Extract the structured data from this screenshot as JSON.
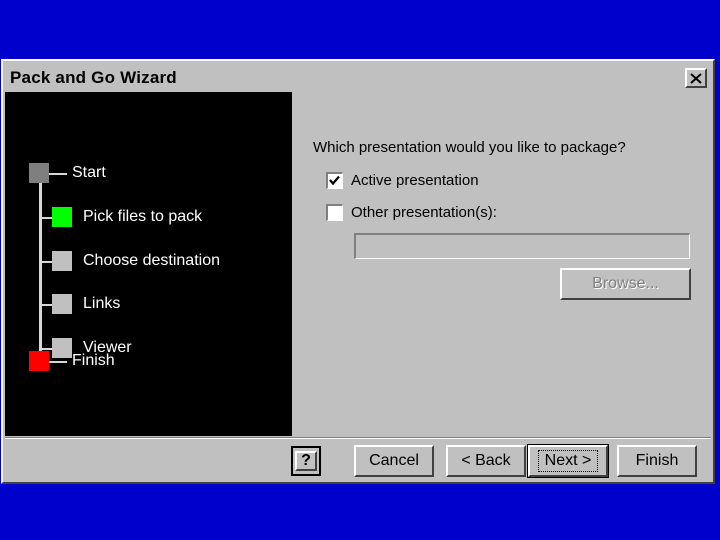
{
  "window": {
    "title": "Pack and Go Wizard",
    "close_icon": "close-icon"
  },
  "steps": [
    {
      "label": "Start",
      "color": "#7f7f7f"
    },
    {
      "label": "Pick files to pack",
      "color": "#00ff00"
    },
    {
      "label": "Choose destination",
      "color": "#c0c0c0"
    },
    {
      "label": "Links",
      "color": "#c0c0c0"
    },
    {
      "label": "Viewer",
      "color": "#c0c0c0"
    },
    {
      "label": "Finish",
      "color": "#ff0000"
    }
  ],
  "content": {
    "question": "Which presentation would you like to package?",
    "options": [
      {
        "label": "Active presentation",
        "checked": true
      },
      {
        "label": "Other presentation(s):",
        "checked": false
      }
    ],
    "path_value": "",
    "browse_label": "Browse..."
  },
  "footer": {
    "help_label": "?",
    "cancel_label": "Cancel",
    "back_label": "< Back",
    "next_label": "Next >",
    "finish_label": "Finish"
  }
}
